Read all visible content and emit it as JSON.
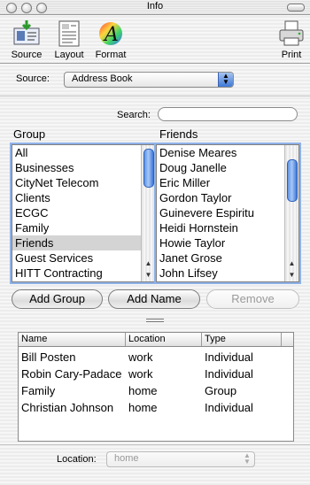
{
  "window": {
    "title": "Info"
  },
  "toolbar": {
    "source_label": "Source",
    "layout_label": "Layout",
    "format_label": "Format",
    "print_label": "Print"
  },
  "source": {
    "label": "Source:",
    "value": "Address Book"
  },
  "search": {
    "label": "Search:",
    "value": ""
  },
  "groups": {
    "header": "Group",
    "items": [
      "All",
      "Businesses",
      "CityNet Telecom",
      "Clients",
      "ECGC",
      "Family",
      "Friends",
      "Guest Services",
      "HITT Contracting"
    ],
    "selected": "Friends"
  },
  "friends": {
    "header": "Friends",
    "items": [
      "Denise Meares",
      "Doug Janelle",
      "Eric Miller",
      "Gordon Taylor",
      "Guinevere Espiritu",
      "Heidi Hornstein",
      "Howie Taylor",
      "Janet Grose",
      "John Lifsey"
    ]
  },
  "buttons": {
    "add_group": "Add Group",
    "add_name": "Add Name",
    "remove": "Remove"
  },
  "table": {
    "headers": {
      "name": "Name",
      "location": "Location",
      "type": "Type"
    },
    "rows": [
      {
        "name": "Bill Posten",
        "location": "work",
        "type": "Individual"
      },
      {
        "name": "Robin Cary-Padace",
        "location": "work",
        "type": "Individual"
      },
      {
        "name": "Family",
        "location": "home",
        "type": "Group"
      },
      {
        "name": "Christian Johnson",
        "location": "home",
        "type": "Individual"
      }
    ]
  },
  "location": {
    "label": "Location:",
    "value": "home"
  },
  "icons": {
    "source": "address-card-icon",
    "layout": "document-layout-icon",
    "format": "color-font-icon",
    "print": "printer-icon"
  }
}
